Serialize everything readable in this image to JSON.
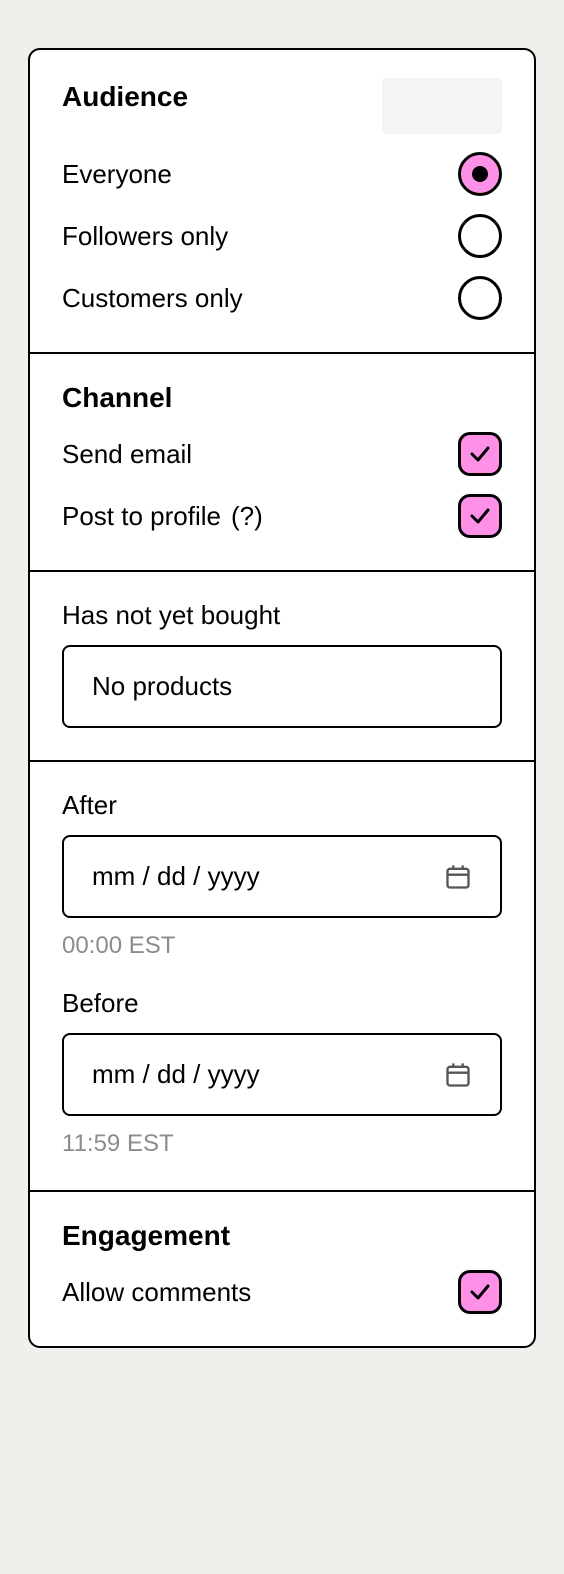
{
  "audience": {
    "title": "Audience",
    "options": [
      {
        "label": "Everyone",
        "selected": true
      },
      {
        "label": "Followers only",
        "selected": false
      },
      {
        "label": "Customers only",
        "selected": false
      }
    ]
  },
  "channel": {
    "title": "Channel",
    "items": [
      {
        "label": "Send email",
        "checked": true,
        "help": false
      },
      {
        "label": "Post to profile",
        "checked": true,
        "help": true
      }
    ],
    "help_glyph": "(?)"
  },
  "bought": {
    "title": "Has not yet bought",
    "value": "No products"
  },
  "after": {
    "title": "After",
    "placeholder": "mm / dd / yyyy",
    "hint": "00:00 EST"
  },
  "before": {
    "title": "Before",
    "placeholder": "mm / dd / yyyy",
    "hint": "11:59 EST"
  },
  "engagement": {
    "title": "Engagement",
    "item": {
      "label": "Allow comments",
      "checked": true
    }
  }
}
